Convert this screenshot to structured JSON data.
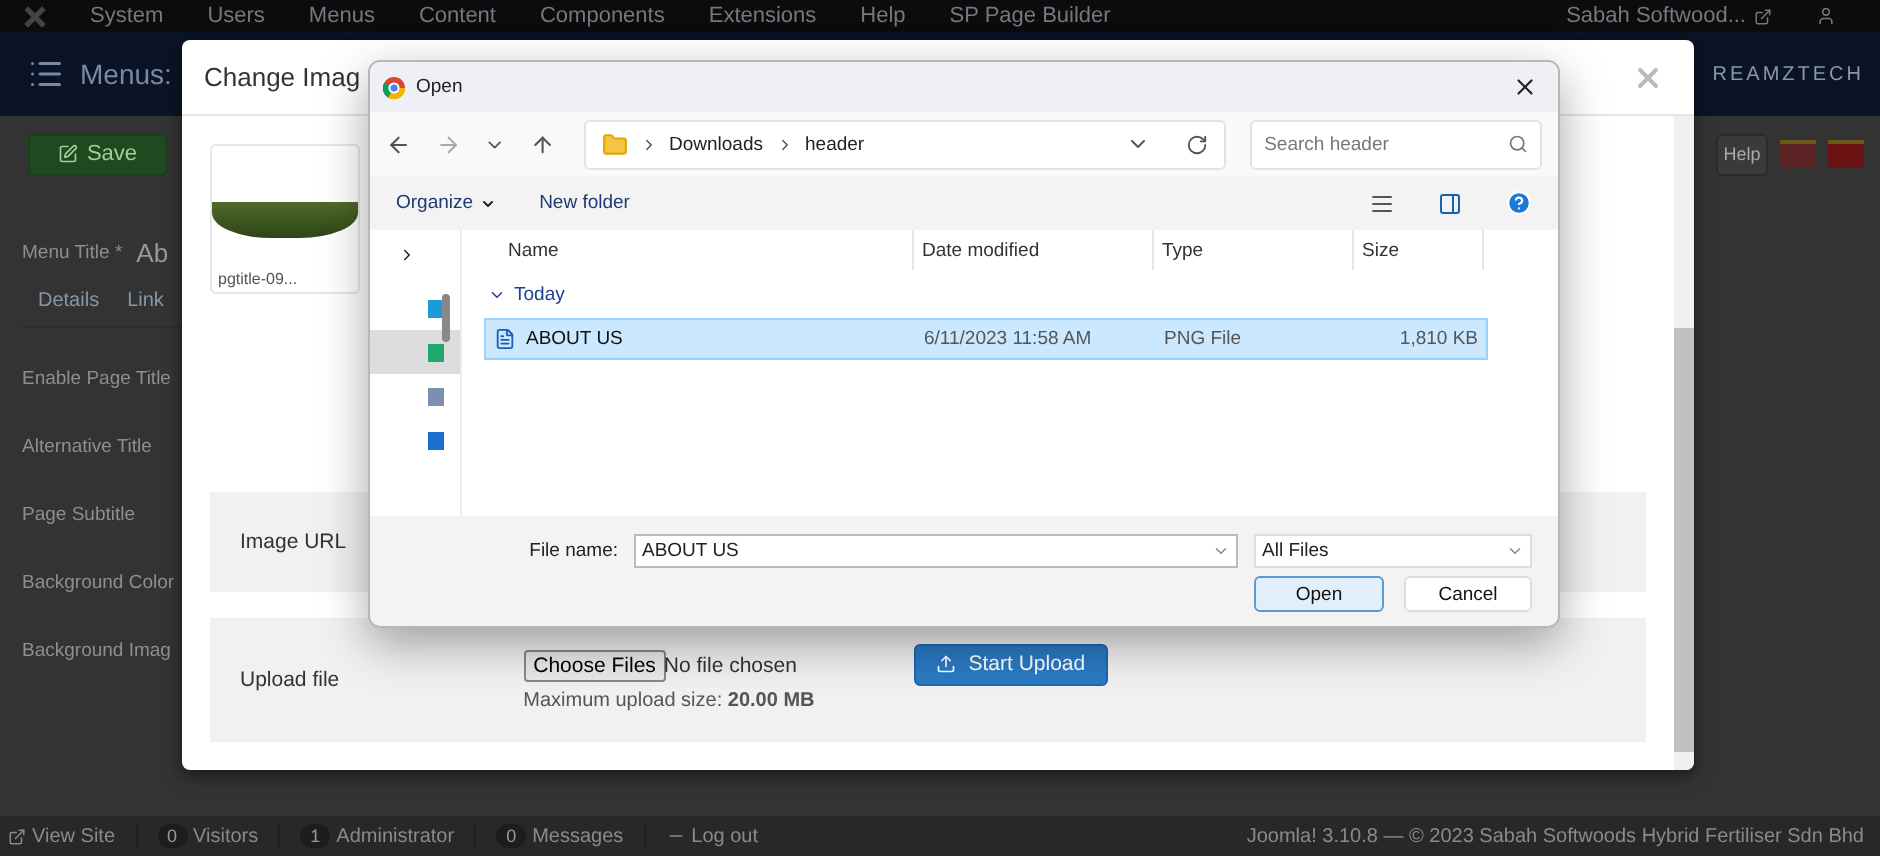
{
  "top_menu": {
    "items": [
      "System",
      "Users",
      "Menus",
      "Content",
      "Components",
      "Extensions",
      "Help",
      "SP Page Builder"
    ],
    "site_link": "Sabah Softwood..."
  },
  "header": {
    "title": "Menus:",
    "logo": "REAMZTECH"
  },
  "toolbar": {
    "save": "Save",
    "help": "Help"
  },
  "form": {
    "title_label": "Menu Title *",
    "title_value": "Ab",
    "tabs": [
      "Details",
      "Link"
    ],
    "fields": [
      "Enable Page Title",
      "Alternative Title",
      "Page Subtitle",
      "Background Color",
      "Background Imag"
    ]
  },
  "status_bar": {
    "view_site": "View Site",
    "counters": [
      {
        "count": "0",
        "label": "Visitors"
      },
      {
        "count": "1",
        "label": "Administrator"
      },
      {
        "count": "0",
        "label": "Messages"
      }
    ],
    "logout": "Log out",
    "copyright": "Joomla! 3.10.8 — © 2023 Sabah Softwoods Hybrid Fertiliser Sdn Bhd"
  },
  "modal": {
    "title": "Change Imag",
    "thumbnail_caption": "pgtitle-09...",
    "image_url_label": "Image URL",
    "upload": {
      "label": "Upload file",
      "choose_button": "Choose Files",
      "no_file": "No file chosen",
      "max_size": "Maximum upload size: **20.00 MB**",
      "start_button": "Start Upload"
    }
  },
  "open_dialog": {
    "title": "Open",
    "path": [
      "Downloads",
      "header"
    ],
    "search_placeholder": "Search header",
    "organize": "Organize",
    "new_folder": "New folder",
    "nav_items": [
      {
        "kind": "desktop",
        "selected": false
      },
      {
        "kind": "downloads",
        "selected": true
      },
      {
        "kind": "documents",
        "selected": false
      },
      {
        "kind": "pictures",
        "selected": false
      }
    ],
    "columns": [
      "Name",
      "Date modified",
      "Type",
      "Size"
    ],
    "groups": [
      {
        "label": "Today",
        "expanded": true,
        "files": [
          {
            "name": "ABOUT US",
            "date": "6/11/2023 11:58 AM",
            "type": "PNG File",
            "size": "1,810 KB",
            "selected": true
          }
        ]
      }
    ],
    "file_name_label": "File name:",
    "file_name": "ABOUT US",
    "filter": "All Files",
    "open_button": "Open",
    "cancel_button": "Cancel"
  }
}
